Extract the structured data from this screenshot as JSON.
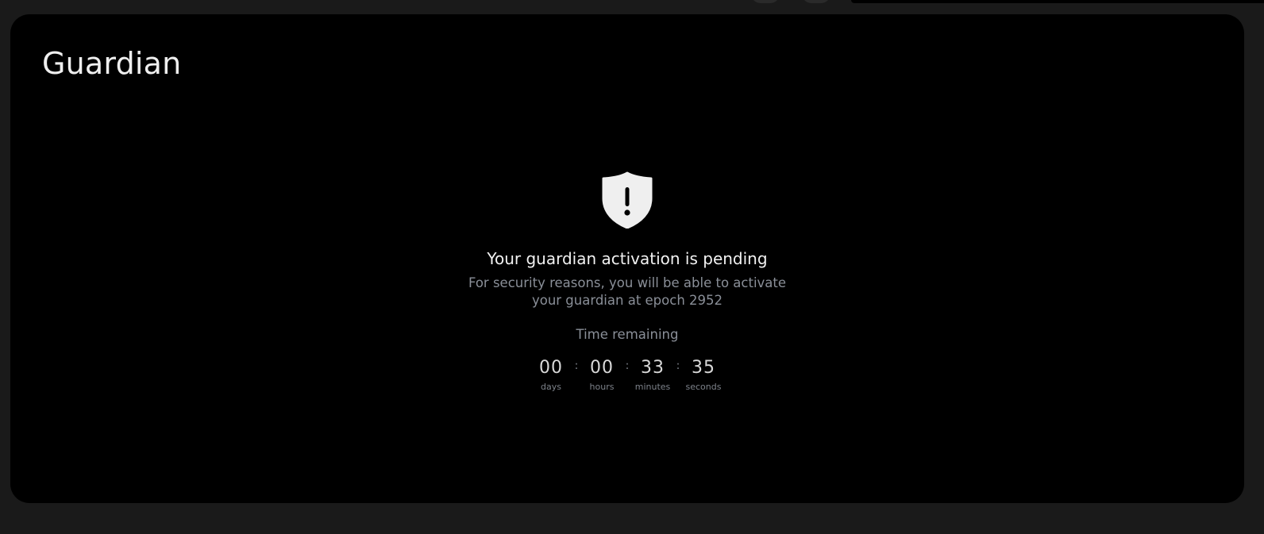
{
  "page": {
    "title": "Guardian"
  },
  "pending": {
    "icon": "shield-alert-icon",
    "headline": "Your guardian activation is pending",
    "description": "For security reasons, you will be able to activate your guardian at epoch 2952",
    "time_label": "Time remaining"
  },
  "countdown": {
    "separator": ":",
    "days": {
      "value": "00",
      "label": "days"
    },
    "hours": {
      "value": "00",
      "label": "hours"
    },
    "minutes": {
      "value": "33",
      "label": "minutes"
    },
    "seconds": {
      "value": "35",
      "label": "seconds"
    }
  },
  "colors": {
    "background": "#1a1a1a",
    "card": "#000000",
    "text_primary": "#f2f2f2",
    "text_muted": "#8a8f98",
    "icon": "#efefef"
  }
}
